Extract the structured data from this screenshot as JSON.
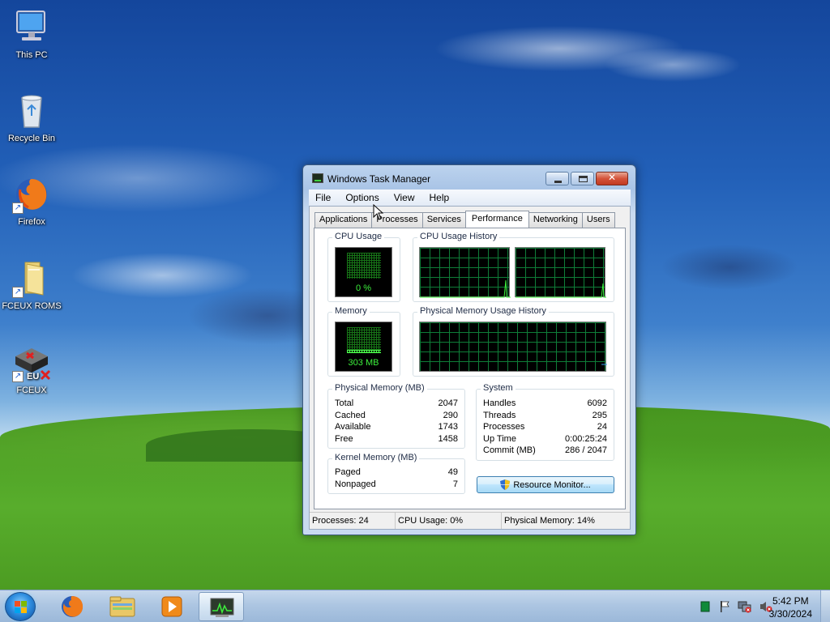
{
  "desktop": {
    "icons": [
      {
        "label": "This PC",
        "icon": "this-pc-icon"
      },
      {
        "label": "Recycle Bin",
        "icon": "recycle-bin-icon"
      },
      {
        "label": "Firefox",
        "icon": "firefox-icon"
      },
      {
        "label": "FCEUX ROMS",
        "icon": "folder-icon"
      },
      {
        "label": "FCEUX",
        "icon": "fceux-icon"
      }
    ]
  },
  "window": {
    "title": "Windows Task Manager",
    "menu": [
      "File",
      "Options",
      "View",
      "Help"
    ],
    "tabs": [
      "Applications",
      "Processes",
      "Services",
      "Performance",
      "Networking",
      "Users"
    ],
    "active_tab": "Performance",
    "performance": {
      "cpu_usage": {
        "title": "CPU Usage",
        "value": "0 %",
        "fraction": 0.0
      },
      "cpu_history": {
        "title": "CPU Usage History"
      },
      "memory": {
        "title": "Memory",
        "value": "303 MB",
        "fraction": 0.14
      },
      "memory_history": {
        "title": "Physical Memory Usage History"
      },
      "physical_memory": {
        "title": "Physical Memory (MB)",
        "rows": [
          {
            "label": "Total",
            "value": "2047"
          },
          {
            "label": "Cached",
            "value": "290"
          },
          {
            "label": "Available",
            "value": "1743"
          },
          {
            "label": "Free",
            "value": "1458"
          }
        ]
      },
      "system": {
        "title": "System",
        "rows": [
          {
            "label": "Handles",
            "value": "6092"
          },
          {
            "label": "Threads",
            "value": "295"
          },
          {
            "label": "Processes",
            "value": "24"
          },
          {
            "label": "Up Time",
            "value": "0:00:25:24"
          },
          {
            "label": "Commit (MB)",
            "value": "286 / 2047"
          }
        ]
      },
      "kernel_memory": {
        "title": "Kernel Memory (MB)",
        "rows": [
          {
            "label": "Paged",
            "value": "49"
          },
          {
            "label": "Nonpaged",
            "value": "7"
          }
        ]
      },
      "resource_monitor_label": "Resource Monitor..."
    },
    "statusbar": {
      "processes": "Processes: 24",
      "cpu": "CPU Usage: 0%",
      "memory": "Physical Memory: 14%"
    }
  },
  "taskbar": {
    "pinned": [
      "firefox-icon",
      "explorer-icon",
      "media-player-icon",
      "task-manager-icon"
    ],
    "clock_time": "5:42 PM",
    "clock_date": "3/30/2024",
    "tray_icons": [
      "network-status-icon",
      "action-center-flag-icon",
      "network-icon",
      "volume-muted-icon"
    ]
  },
  "colors": {
    "meter_green": "#3cf03c",
    "grid_green": "#0f7d38",
    "titlebar": "#bcd3ee"
  }
}
